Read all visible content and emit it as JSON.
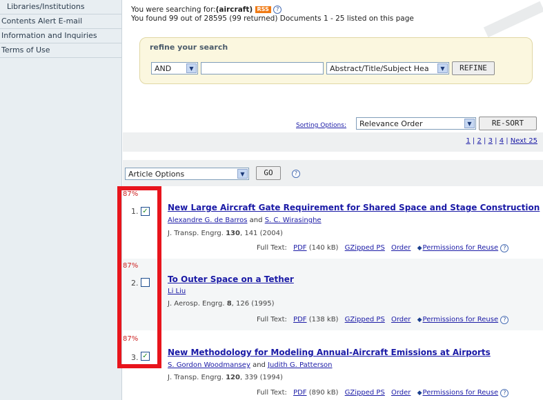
{
  "sidebar": {
    "items": [
      {
        "label": "Libraries/Institutions"
      },
      {
        "label": "Contents Alert E-mail"
      },
      {
        "label": "Information and Inquiries"
      },
      {
        "label": "Terms of Use"
      }
    ]
  },
  "search_info": {
    "searching_prefix": "You were searching for:",
    "query": "(aircraft)",
    "rss_badge": "RSS",
    "help_glyph": "?",
    "found_text": "You found 99 out of 28595 (99 returned) Documents 1 - 25 listed on this page"
  },
  "refine": {
    "title": "refine your search",
    "operator_value": "AND",
    "text_value": "",
    "field_value": "Abstract/Title/Subject Hea",
    "button_label": "REFINE"
  },
  "sorting": {
    "label": "Sorting Options:",
    "selected": "Relevance Order",
    "button_label": "RE-SORT"
  },
  "pagination": {
    "pages": [
      "1",
      "2",
      "3",
      "4"
    ],
    "next_label": "Next 25"
  },
  "article_options": {
    "selected": "Article Options",
    "button_label": "GO",
    "help_glyph": "?"
  },
  "results": [
    {
      "number": "1.",
      "relevance": "87%",
      "checked": true,
      "title": "New Large Aircraft Gate Requirement for Shared Space and Stage Construction",
      "authors": [
        "Alexandre G. de Barros",
        "S. C. Wirasinghe"
      ],
      "journal": "J. Transp. Engrg.",
      "volume": "130",
      "pages_year": ", 141 (2004)",
      "full_text_label": "Full Text:",
      "pdf_label": "PDF",
      "pdf_size": "(140 kB)",
      "gzip_label": "GZipped PS",
      "order_label": "Order",
      "permissions_label": "Permissions for Reuse"
    },
    {
      "number": "2.",
      "relevance": "87%",
      "checked": false,
      "title": "To Outer Space on a Tether",
      "authors": [
        "Li Liu"
      ],
      "journal": "J. Aerosp. Engrg.",
      "volume": "8",
      "pages_year": ", 126 (1995)",
      "full_text_label": "Full Text:",
      "pdf_label": "PDF",
      "pdf_size": "(138 kB)",
      "gzip_label": "GZipped PS",
      "order_label": "Order",
      "permissions_label": "Permissions for Reuse"
    },
    {
      "number": "3.",
      "relevance": "87%",
      "checked": true,
      "title": "New Methodology for Modeling Annual-Aircraft Emissions at Airports",
      "authors": [
        "S. Gordon Woodmansey",
        "Judith G. Patterson"
      ],
      "journal": "J. Transp. Engrg.",
      "volume": "120",
      "pages_year": ", 339 (1994)",
      "full_text_label": "Full Text:",
      "pdf_label": "PDF",
      "pdf_size": "(890 kB)",
      "gzip_label": "GZipped PS",
      "order_label": "Order",
      "permissions_label": "Permissions for Reuse"
    }
  ],
  "authors_joiner": "and",
  "colors": {
    "sidebar_bg": "#e8eef2",
    "link": "#1a1aa6",
    "highlight": "#e8141c",
    "relevance": "#cc2020",
    "refine_bg": "#fbf7df"
  }
}
